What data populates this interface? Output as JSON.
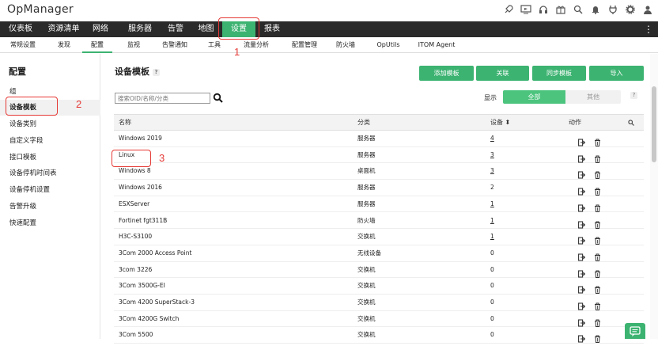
{
  "app": {
    "title": "OpManager"
  },
  "topbar_icons": [
    "rocket-icon",
    "tv-icon",
    "headset-icon",
    "gift-icon",
    "search-icon",
    "bell-icon",
    "plug-icon",
    "gear-icon",
    "user-icon"
  ],
  "main_nav": {
    "items": [
      {
        "label": "仪表板"
      },
      {
        "label": "资源清单"
      },
      {
        "label": "网络"
      },
      {
        "label": "服务器"
      },
      {
        "label": "告警"
      },
      {
        "label": "地图"
      },
      {
        "label": "设置",
        "active": true
      },
      {
        "label": "报表"
      }
    ],
    "menu": "⋮"
  },
  "sub_nav": {
    "items": [
      {
        "label": "常规设置"
      },
      {
        "label": "发现"
      },
      {
        "label": "配置",
        "active": true
      },
      {
        "label": "监视"
      },
      {
        "label": "告警通知"
      },
      {
        "label": "工具"
      },
      {
        "label": "流量分析"
      },
      {
        "label": "配置管理"
      },
      {
        "label": "防火墙"
      },
      {
        "label": "OpUtils"
      },
      {
        "label": "ITOM Agent"
      }
    ]
  },
  "annotations": {
    "one": "1",
    "two": "2",
    "three": "3"
  },
  "sidebar": {
    "title": "配置",
    "items": [
      {
        "label": "组"
      },
      {
        "label": "设备模板",
        "active": true
      },
      {
        "label": "设备类别"
      },
      {
        "label": "自定义字段"
      },
      {
        "label": "接口模板"
      },
      {
        "label": "设备停机时间表"
      },
      {
        "label": "设备停机设置"
      },
      {
        "label": "告警升级"
      },
      {
        "label": "快速配置"
      }
    ]
  },
  "content": {
    "title": "设备模板",
    "help": "?",
    "buttons": {
      "add": "添加模板",
      "associate": "关联",
      "sync": "同步模板",
      "import": "导入"
    },
    "search": {
      "placeholder": "搜索OID/名称/分类"
    },
    "filter": {
      "label": "显示",
      "all": "全部",
      "other": "其他",
      "help": "?"
    }
  },
  "table": {
    "columns": {
      "name": "名称",
      "category": "分类",
      "devices": "设备 ⬍",
      "actions": "动作"
    },
    "rows": [
      {
        "name": "Windows 2019",
        "category": "服务器",
        "devices": "4",
        "link": true
      },
      {
        "name": "Linux",
        "category": "服务器",
        "devices": "3",
        "link": true
      },
      {
        "name": "Windows 8",
        "category": "桌面机",
        "devices": "3",
        "link": true
      },
      {
        "name": "Windows 2016",
        "category": "服务器",
        "devices": "2",
        "link": false
      },
      {
        "name": "ESXServer",
        "category": "服务器",
        "devices": "1",
        "link": true
      },
      {
        "name": "Fortinet fgt311B",
        "category": "防火墙",
        "devices": "1",
        "link": true
      },
      {
        "name": "H3C-S3100",
        "category": "交换机",
        "devices": "1",
        "link": true
      },
      {
        "name": "3Com 2000 Access Point",
        "category": "无线设备",
        "devices": "0",
        "link": false
      },
      {
        "name": "3com 3226",
        "category": "交换机",
        "devices": "0",
        "link": false
      },
      {
        "name": "3Com 3500G-EI",
        "category": "交换机",
        "devices": "0",
        "link": false
      },
      {
        "name": "3Com 4200 SuperStack-3",
        "category": "交换机",
        "devices": "0",
        "link": false
      },
      {
        "name": "3Com 4200G Switch",
        "category": "交换机",
        "devices": "0",
        "link": false
      },
      {
        "name": "3Com 5500",
        "category": "交换机",
        "devices": "0",
        "link": false
      }
    ]
  },
  "colors": {
    "accent": "#3cb371",
    "nav_bg": "#2a2a2a",
    "annotation": "#e53935"
  }
}
